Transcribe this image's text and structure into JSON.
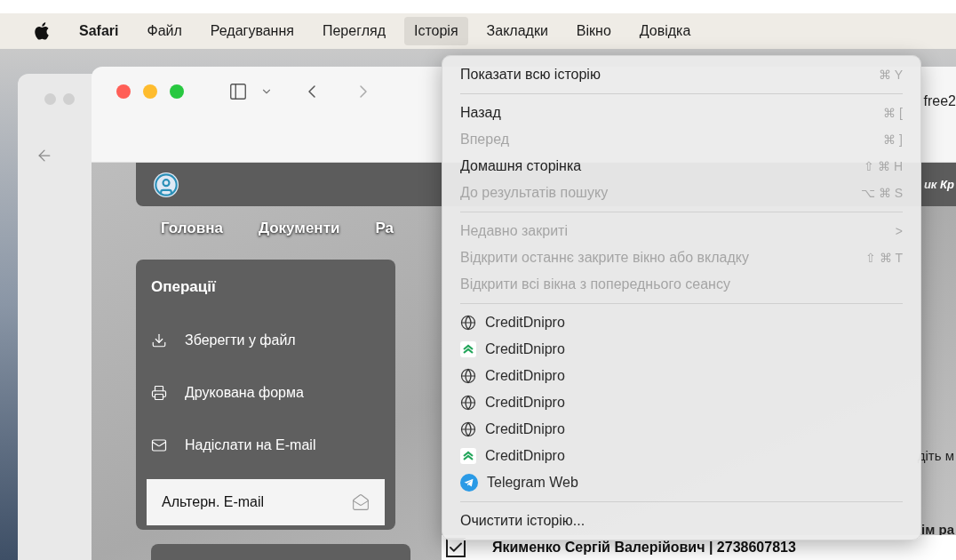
{
  "menu_bar": {
    "items": [
      {
        "label": "Safari",
        "bold": true,
        "selected": false
      },
      {
        "label": "Файл",
        "bold": false,
        "selected": false
      },
      {
        "label": "Редагування",
        "bold": false,
        "selected": false
      },
      {
        "label": "Перегляд",
        "bold": false,
        "selected": false
      },
      {
        "label": "Історія",
        "bold": false,
        "selected": true
      },
      {
        "label": "Закладки",
        "bold": false,
        "selected": false
      },
      {
        "label": "Вікно",
        "bold": false,
        "selected": false
      },
      {
        "label": "Довідка",
        "bold": false,
        "selected": false
      }
    ]
  },
  "browser": {
    "address_fragment": "free2",
    "header_fragment": "ик Кр",
    "nav": [
      "Головна",
      "Документи",
      "Ра"
    ],
    "operations": {
      "title": "Операції",
      "items": [
        {
          "label": "Зберегти у файл"
        },
        {
          "label": "Друкована форма"
        },
        {
          "label": "Надіслати на E-mail"
        }
      ],
      "alt_email": "Альтерн. E-mail"
    },
    "fragments": [
      "діть м",
      "ім ра"
    ],
    "checkbox_row": {
      "label": "Якименко Сергій Валерійович | 2738607813",
      "checked": true
    }
  },
  "history_menu": {
    "items": [
      {
        "kind": "item",
        "label": "Показати всю історію",
        "shortcut": "⌘ Y",
        "disabled": false
      },
      {
        "kind": "separator"
      },
      {
        "kind": "item",
        "label": "Назад",
        "shortcut": "⌘ [",
        "disabled": false
      },
      {
        "kind": "item",
        "label": "Вперед",
        "shortcut": "⌘ ]",
        "disabled": true
      },
      {
        "kind": "item",
        "label": "Домашня сторінка",
        "shortcut": "⇧ ⌘ H",
        "disabled": false
      },
      {
        "kind": "item",
        "label": "До результатів пошуку",
        "shortcut": "⌥ ⌘ S",
        "disabled": true
      },
      {
        "kind": "separator"
      },
      {
        "kind": "submenu",
        "label": "Недавно закриті",
        "shortcut": ">",
        "disabled": true
      },
      {
        "kind": "item",
        "label": "Відкрити останнє закрите вікно або вкладку",
        "shortcut": "⇧ ⌘ T",
        "disabled": true
      },
      {
        "kind": "item",
        "label": "Відкрити всі вікна з попереднього сеансу",
        "disabled": true
      },
      {
        "kind": "separator"
      },
      {
        "kind": "globe",
        "label": "CreditDnipro"
      },
      {
        "kind": "app",
        "label": "CreditDnipro"
      },
      {
        "kind": "globe",
        "label": "CreditDnipro"
      },
      {
        "kind": "globe",
        "label": "CreditDnipro"
      },
      {
        "kind": "globe",
        "label": "CreditDnipro"
      },
      {
        "kind": "app",
        "label": "CreditDnipro"
      },
      {
        "kind": "telegram",
        "label": "Telegram Web"
      },
      {
        "kind": "separator"
      },
      {
        "kind": "item",
        "label": "Очистити історію...",
        "disabled": false
      }
    ]
  }
}
